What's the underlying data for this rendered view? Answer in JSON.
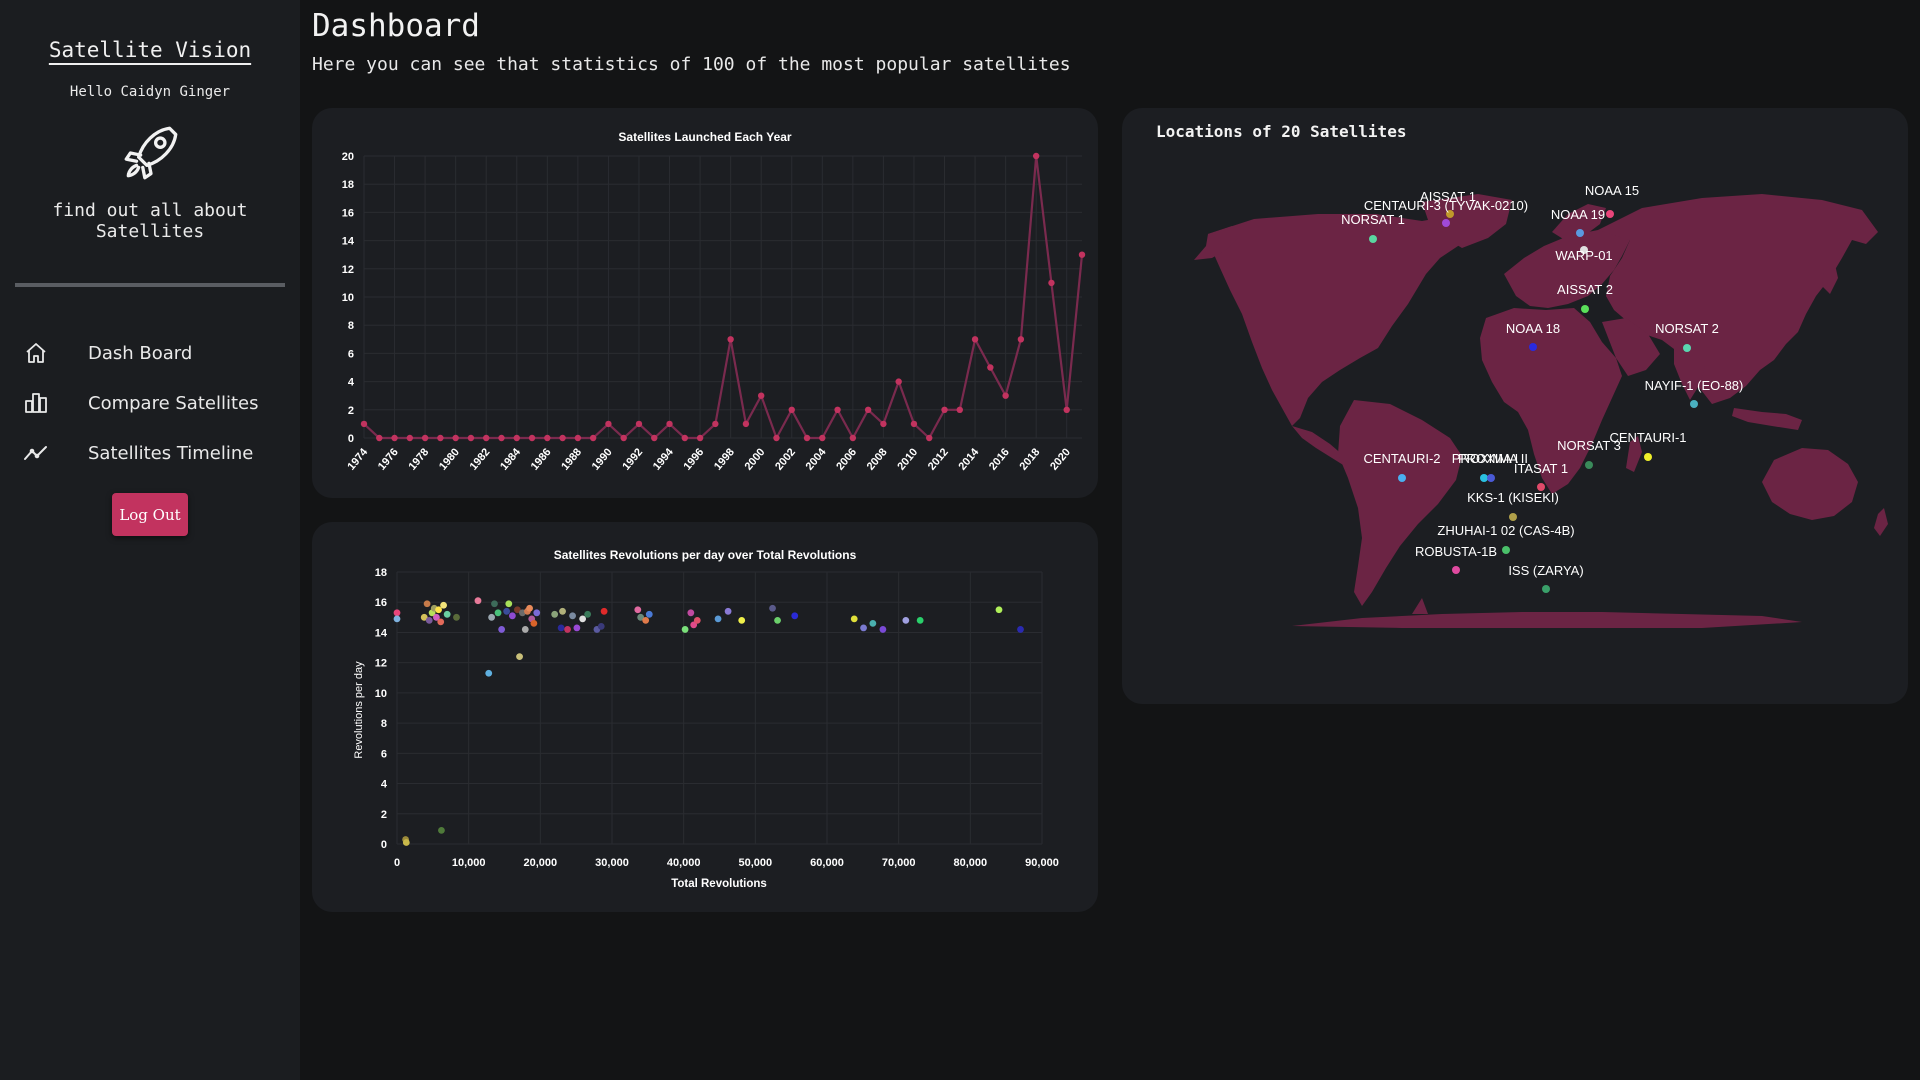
{
  "sidebar": {
    "brand": "Satellite Vision",
    "greeting": "Hello Caidyn Ginger",
    "tagline_line1": "find out all about",
    "tagline_line2": "Satellites",
    "nav": [
      {
        "label": "Dash Board",
        "icon": "home-icon"
      },
      {
        "label": "Compare Satellites",
        "icon": "bar-chart-icon"
      },
      {
        "label": "Satellites Timeline",
        "icon": "trend-line-icon"
      }
    ],
    "logout_label": "Log Out"
  },
  "header": {
    "title": "Dashboard",
    "subtitle": "Here you can see that statistics of 100 of the most popular satellites"
  },
  "colors": {
    "accent": "#c2335f",
    "line": "#7a2a4e",
    "map_land": "#6b2444",
    "card": "#1c1e22"
  },
  "chart_data": [
    {
      "type": "line",
      "title": "Satellites Launched Each Year",
      "x": [
        1974,
        1975,
        1976,
        1977,
        1978,
        1979,
        1980,
        1981,
        1982,
        1983,
        1984,
        1985,
        1986,
        1987,
        1988,
        1989,
        1990,
        1991,
        1992,
        1993,
        1994,
        1995,
        1996,
        1997,
        1998,
        1999,
        2000,
        2001,
        2002,
        2003,
        2004,
        2005,
        2006,
        2007,
        2008,
        2009,
        2010,
        2011,
        2012,
        2013,
        2014,
        2015,
        2016,
        2017,
        2018,
        2019,
        2020,
        2021
      ],
      "y": [
        1,
        0,
        0,
        0,
        0,
        0,
        0,
        0,
        0,
        0,
        0,
        0,
        0,
        0,
        0,
        0,
        1,
        0,
        1,
        0,
        1,
        0,
        0,
        1,
        7,
        1,
        3,
        0,
        2,
        0,
        0,
        2,
        0,
        2,
        1,
        4,
        1,
        0,
        2,
        2,
        7,
        5,
        3,
        7,
        20,
        11,
        2,
        13
      ],
      "xticks": [
        "1974",
        "1976",
        "1978",
        "1980",
        "1982",
        "1984",
        "1986",
        "1988",
        "1990",
        "1992",
        "1994",
        "1996",
        "1998",
        "2000",
        "2002",
        "2004",
        "2006",
        "2008",
        "2010",
        "2012",
        "2014",
        "2016",
        "2018",
        "2020"
      ],
      "ylim": [
        0,
        20
      ],
      "yticks": [
        "0",
        "2",
        "4",
        "6",
        "8",
        "10",
        "12",
        "14",
        "16",
        "18",
        "20"
      ],
      "grid": true
    },
    {
      "type": "scatter",
      "title": "Satellites Revolutions per day over Total Revolutions",
      "xlabel": "Total Revolutions",
      "ylabel": "Revolutions per day",
      "xlim": [
        0,
        90000
      ],
      "ylim": [
        0,
        18
      ],
      "xticks": [
        "0",
        "10,000",
        "20,000",
        "30,000",
        "40,000",
        "50,000",
        "60,000",
        "70,000",
        "80,000",
        "90,000"
      ],
      "yticks": [
        "0",
        "2",
        "4",
        "6",
        "8",
        "10",
        "12",
        "14",
        "16",
        "18"
      ],
      "grid": true,
      "points": [
        {
          "x": 0,
          "y": 15.3,
          "c": "#e9457a"
        },
        {
          "x": 0,
          "y": 14.9,
          "c": "#7fb3e0"
        },
        {
          "x": 1200,
          "y": 0.3,
          "c": "#9c8a3a"
        },
        {
          "x": 1300,
          "y": 0.1,
          "c": "#c9b94a"
        },
        {
          "x": 6200,
          "y": 0.9,
          "c": "#4f7a3a"
        },
        {
          "x": 3800,
          "y": 15.0,
          "c": "#d4c15a"
        },
        {
          "x": 4200,
          "y": 15.9,
          "c": "#c77b4a"
        },
        {
          "x": 4500,
          "y": 14.8,
          "c": "#7a5b9b"
        },
        {
          "x": 4900,
          "y": 15.3,
          "c": "#b7e05a"
        },
        {
          "x": 5200,
          "y": 15.6,
          "c": "#a0a060"
        },
        {
          "x": 5500,
          "y": 15.0,
          "c": "#d060c0"
        },
        {
          "x": 5800,
          "y": 15.5,
          "c": "#ffe34a"
        },
        {
          "x": 6100,
          "y": 14.7,
          "c": "#e26a5a"
        },
        {
          "x": 6500,
          "y": 15.8,
          "c": "#f2e37a"
        },
        {
          "x": 7000,
          "y": 15.2,
          "c": "#6bd0a0"
        },
        {
          "x": 8300,
          "y": 15.0,
          "c": "#5a6b3a"
        },
        {
          "x": 11300,
          "y": 16.1,
          "c": "#e87a9a"
        },
        {
          "x": 12800,
          "y": 11.3,
          "c": "#5fb0e0"
        },
        {
          "x": 13200,
          "y": 15.0,
          "c": "#9aa7b0"
        },
        {
          "x": 13600,
          "y": 15.9,
          "c": "#3d6b5a"
        },
        {
          "x": 14100,
          "y": 15.3,
          "c": "#48c07a"
        },
        {
          "x": 14600,
          "y": 14.2,
          "c": "#7f5bd6"
        },
        {
          "x": 15300,
          "y": 15.4,
          "c": "#3a4c9a"
        },
        {
          "x": 15600,
          "y": 15.9,
          "c": "#a8e05a"
        },
        {
          "x": 16100,
          "y": 15.1,
          "c": "#8f4ad0"
        },
        {
          "x": 16800,
          "y": 15.5,
          "c": "#7a3a2a"
        },
        {
          "x": 17100,
          "y": 12.4,
          "c": "#c9c07a"
        },
        {
          "x": 17500,
          "y": 15.3,
          "c": "#6b6b6b"
        },
        {
          "x": 17900,
          "y": 14.2,
          "c": "#aaaaaa"
        },
        {
          "x": 18200,
          "y": 15.4,
          "c": "#d07a50"
        },
        {
          "x": 18500,
          "y": 15.6,
          "c": "#e88a5a"
        },
        {
          "x": 18800,
          "y": 14.9,
          "c": "#b05a9a"
        },
        {
          "x": 19100,
          "y": 14.6,
          "c": "#d9642a"
        },
        {
          "x": 19500,
          "y": 15.3,
          "c": "#7a6bd6"
        },
        {
          "x": 22000,
          "y": 15.2,
          "c": "#8aa37a"
        },
        {
          "x": 22900,
          "y": 14.3,
          "c": "#2a2a9a"
        },
        {
          "x": 23100,
          "y": 15.4,
          "c": "#b0b07a"
        },
        {
          "x": 23800,
          "y": 14.2,
          "c": "#c2335f"
        },
        {
          "x": 24500,
          "y": 15.1,
          "c": "#7a8aa0"
        },
        {
          "x": 25100,
          "y": 14.3,
          "c": "#9a4ad6"
        },
        {
          "x": 25900,
          "y": 14.9,
          "c": "#e0e0e0"
        },
        {
          "x": 26600,
          "y": 15.2,
          "c": "#3a7a5a"
        },
        {
          "x": 27900,
          "y": 14.2,
          "c": "#5a5aa0"
        },
        {
          "x": 28500,
          "y": 14.4,
          "c": "#3a3a7a"
        },
        {
          "x": 28900,
          "y": 15.4,
          "c": "#e02a2a"
        },
        {
          "x": 33600,
          "y": 15.5,
          "c": "#e06aa0"
        },
        {
          "x": 34000,
          "y": 15.0,
          "c": "#6b8a7a"
        },
        {
          "x": 34700,
          "y": 14.8,
          "c": "#e07a4a"
        },
        {
          "x": 35200,
          "y": 15.2,
          "c": "#4a7ad6"
        },
        {
          "x": 40200,
          "y": 14.2,
          "c": "#7ae07a"
        },
        {
          "x": 41000,
          "y": 15.3,
          "c": "#c04aa0"
        },
        {
          "x": 41400,
          "y": 14.5,
          "c": "#e04a8a"
        },
        {
          "x": 41900,
          "y": 14.8,
          "c": "#e0506a"
        },
        {
          "x": 44800,
          "y": 14.9,
          "c": "#5a9ad6"
        },
        {
          "x": 46200,
          "y": 15.4,
          "c": "#8a7ad6"
        },
        {
          "x": 48100,
          "y": 14.8,
          "c": "#f0f04a"
        },
        {
          "x": 52400,
          "y": 15.6,
          "c": "#5a5a8a"
        },
        {
          "x": 53100,
          "y": 14.8,
          "c": "#6bd06b"
        },
        {
          "x": 55500,
          "y": 15.1,
          "c": "#2a2ad6"
        },
        {
          "x": 63800,
          "y": 14.9,
          "c": "#e0e03a"
        },
        {
          "x": 65100,
          "y": 14.3,
          "c": "#7a7ad0"
        },
        {
          "x": 66400,
          "y": 14.6,
          "c": "#4ab0b0"
        },
        {
          "x": 67800,
          "y": 14.2,
          "c": "#7a4ad6"
        },
        {
          "x": 71000,
          "y": 14.8,
          "c": "#a0a0e0"
        },
        {
          "x": 73000,
          "y": 14.8,
          "c": "#2ad06b"
        },
        {
          "x": 84000,
          "y": 15.5,
          "c": "#b0f05a"
        },
        {
          "x": 87000,
          "y": 14.2,
          "c": "#2a2ab0"
        }
      ]
    }
  ],
  "map": {
    "title": "Locations of 20 Satellites",
    "markers": [
      {
        "label": "NOAA 15",
        "c": "#e9457a"
      },
      {
        "label": "AISSAT 1",
        "c": "#c09a2a"
      },
      {
        "label": "CENTAURI-3 (TYVAK-0210)",
        "c": "#a04ad6"
      },
      {
        "label": "NORSAT 1",
        "c": "#5ad6a0"
      },
      {
        "label": "NOAA 19",
        "c": "#5a9ae0"
      },
      {
        "label": "WARP-01",
        "c": "#e0e0e0"
      },
      {
        "label": "AISSAT 2",
        "c": "#5ae05a"
      },
      {
        "label": "NOAA 18",
        "c": "#2a2ae0"
      },
      {
        "label": "NORSAT 2",
        "c": "#5ad6b0"
      },
      {
        "label": "NAYIF-1 (EO-88)",
        "c": "#4ab0c0"
      },
      {
        "label": "CENTAURI-1",
        "c": "#f0f02a"
      },
      {
        "label": "NORSAT 3",
        "c": "#3a8a5a"
      },
      {
        "label": "CENTAURI-2",
        "c": "#4ab0f0"
      },
      {
        "label": "PROXIMA I",
        "c": "#2ac0e0"
      },
      {
        "label": "PROXIMA II",
        "c": "#4a5ad6"
      },
      {
        "label": "ITASAT 1",
        "c": "#e04a6a"
      },
      {
        "label": "KKS-1 (KISEKI)",
        "c": "#b0a04a"
      },
      {
        "label": "ZHUHAI-1 02 (CAS-4B)",
        "c": "#4ac06a"
      },
      {
        "label": "ROBUSTA-1B",
        "c": "#e04aa0"
      },
      {
        "label": "ISS (ZARYA)",
        "c": "#3aa06a"
      }
    ]
  }
}
